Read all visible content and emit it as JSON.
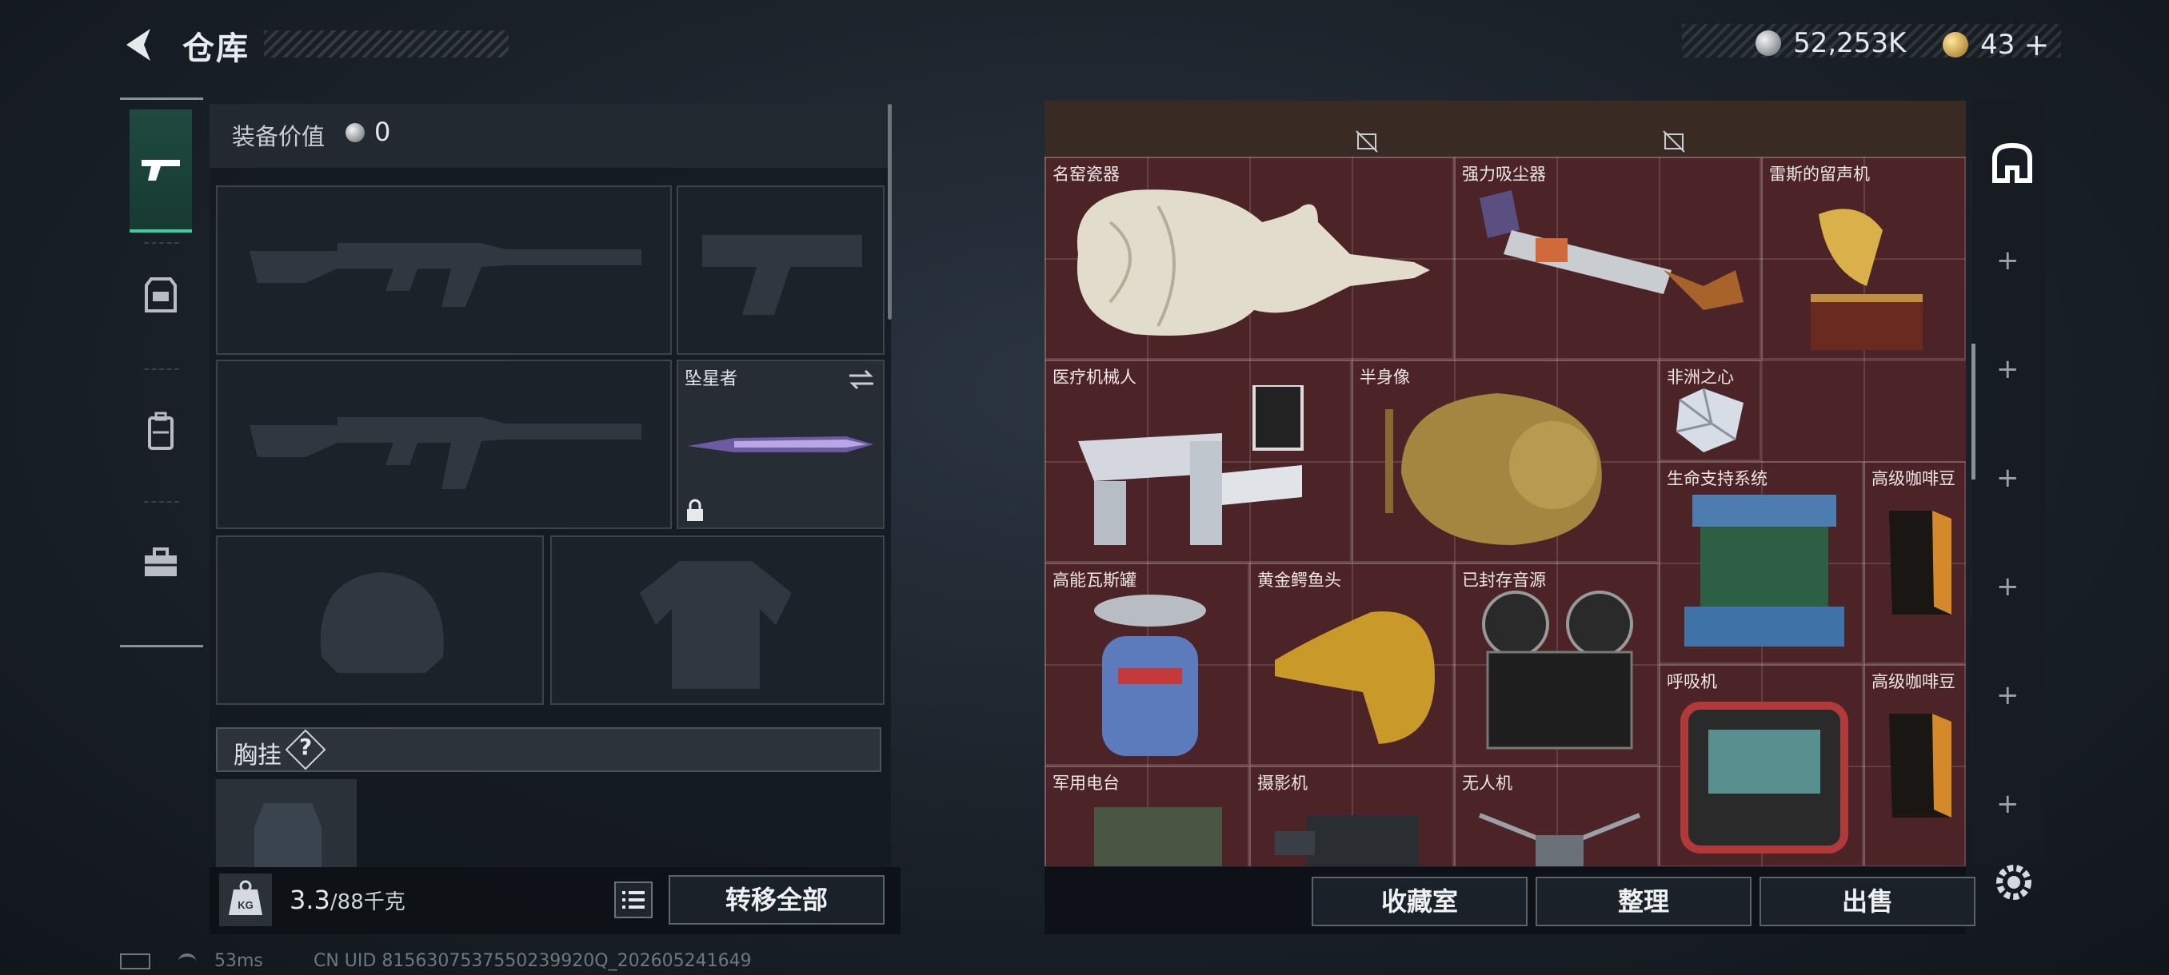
{
  "header": {
    "title": "仓库",
    "silver_amount": "52,253K",
    "gold_amount": "43",
    "gold_add": "+"
  },
  "equipment": {
    "value_label": "装备价值",
    "value": "0",
    "melee_name": "坠星者",
    "chest_label": "胸挂",
    "chest_help": "?"
  },
  "footer_left": {
    "weight_current": "3.3",
    "weight_max": "/88千克",
    "kg_label": "KG",
    "transfer_all": "转移全部"
  },
  "stash": {
    "items": [
      {
        "name": "名窑瓷器"
      },
      {
        "name": "强力吸尘器"
      },
      {
        "name": "雷斯的留声机"
      },
      {
        "name": "医疗机械人"
      },
      {
        "name": "半身像"
      },
      {
        "name": "非洲之心"
      },
      {
        "name": "生命支持系统"
      },
      {
        "name": "高级咖啡豆"
      },
      {
        "name": "高能瓦斯罐"
      },
      {
        "name": "黄金鳄鱼头"
      },
      {
        "name": "已封存音源"
      },
      {
        "name": "呼吸机"
      },
      {
        "name": "高级咖啡豆"
      },
      {
        "name": "军用电台"
      },
      {
        "name": "摄影机"
      },
      {
        "name": "无人机"
      }
    ]
  },
  "footer_right": {
    "collection": "收藏室",
    "sort": "整理",
    "sell": "出售"
  },
  "status": {
    "ping": "53ms",
    "uid": "CN UID 8156307537550239920Q_202605241649"
  },
  "colors": {
    "stash_bg": "#4c2327",
    "accent_green": "#35d39b"
  }
}
